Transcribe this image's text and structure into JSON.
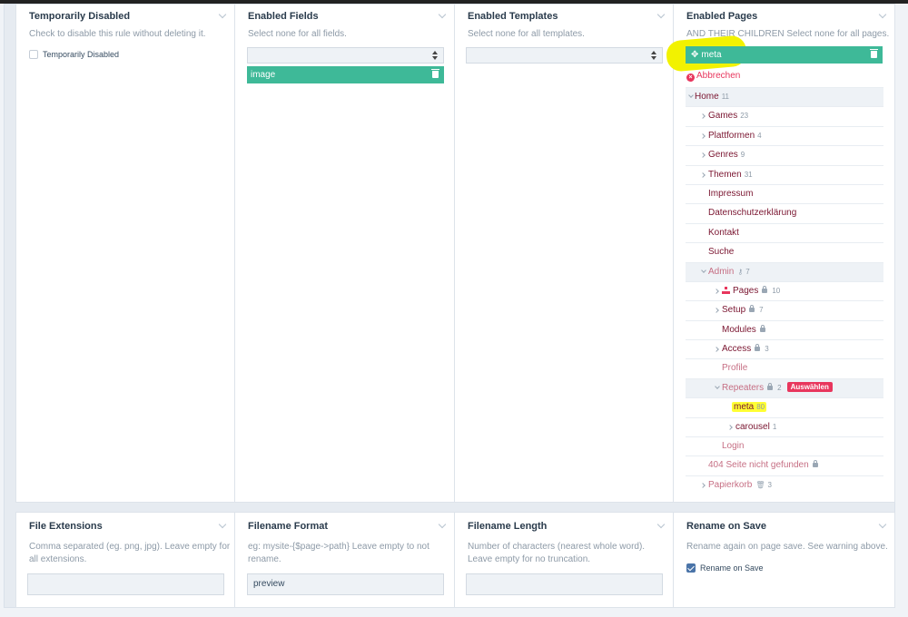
{
  "fields": {
    "temporarily_disabled": {
      "title": "Temporarily Disabled",
      "description": "Check to disable this rule without deleting it.",
      "checkbox_label": "Temporarily Disabled",
      "checked": false
    },
    "enabled_fields": {
      "title": "Enabled Fields",
      "description": "Select none for all fields.",
      "selected_item": "image"
    },
    "enabled_templates": {
      "title": "Enabled Templates",
      "description": "Select none for all templates."
    },
    "enabled_pages": {
      "title": "Enabled Pages",
      "description": "AND THEIR CHILDREN Select none for all pages.",
      "selected_item": "meta",
      "cancel_label": "Abbrechen"
    },
    "file_extensions": {
      "title": "File Extensions",
      "description_line1": "Comma separated (eg. png, jpg). Leave empty for",
      "description_line2": "all extensions.",
      "value": ""
    },
    "filename_format": {
      "title": "Filename Format",
      "description_line1": "eg: mysite-{$page->path} Leave empty to not",
      "description_line2": "rename.",
      "value": "preview"
    },
    "filename_length": {
      "title": "Filename Length",
      "description_line1": "Number of characters (nearest whole word).",
      "description_line2": "Leave empty for no truncation.",
      "value": ""
    },
    "rename_on_save": {
      "title": "Rename on Save",
      "description": "Rename again on page save. See warning above.",
      "checkbox_label": "Rename on Save",
      "checked": true
    }
  },
  "tree": {
    "home": {
      "label": "Home",
      "count": "11"
    },
    "games": {
      "label": "Games",
      "count": "23"
    },
    "plattformen": {
      "label": "Plattformen",
      "count": "4"
    },
    "genres": {
      "label": "Genres",
      "count": "9"
    },
    "themen": {
      "label": "Themen",
      "count": "31"
    },
    "impressum": {
      "label": "Impressum"
    },
    "datenschutz": {
      "label": "Datenschutzerklärung"
    },
    "kontakt": {
      "label": "Kontakt"
    },
    "suche": {
      "label": "Suche"
    },
    "admin": {
      "label": "Admin",
      "count": "7"
    },
    "pages": {
      "label": "Pages",
      "count": "10"
    },
    "setup": {
      "label": "Setup",
      "count": "7"
    },
    "modules": {
      "label": "Modules"
    },
    "access": {
      "label": "Access",
      "count": "3"
    },
    "profile": {
      "label": "Profile"
    },
    "repeaters": {
      "label": "Repeaters",
      "count": "2",
      "badge": "Auswählen"
    },
    "meta": {
      "label": "meta",
      "count": "80"
    },
    "carousel": {
      "label": "carousel",
      "count": "1"
    },
    "login": {
      "label": "Login"
    },
    "notfound": {
      "label": "404 Seite nicht gefunden"
    },
    "papierkorb": {
      "label": "Papierkorb",
      "count": "3"
    }
  },
  "colors": {
    "accent_green": "#3eb998",
    "link": "#7a1530",
    "badge": "#e8365d",
    "highlight": "#ffff33"
  }
}
